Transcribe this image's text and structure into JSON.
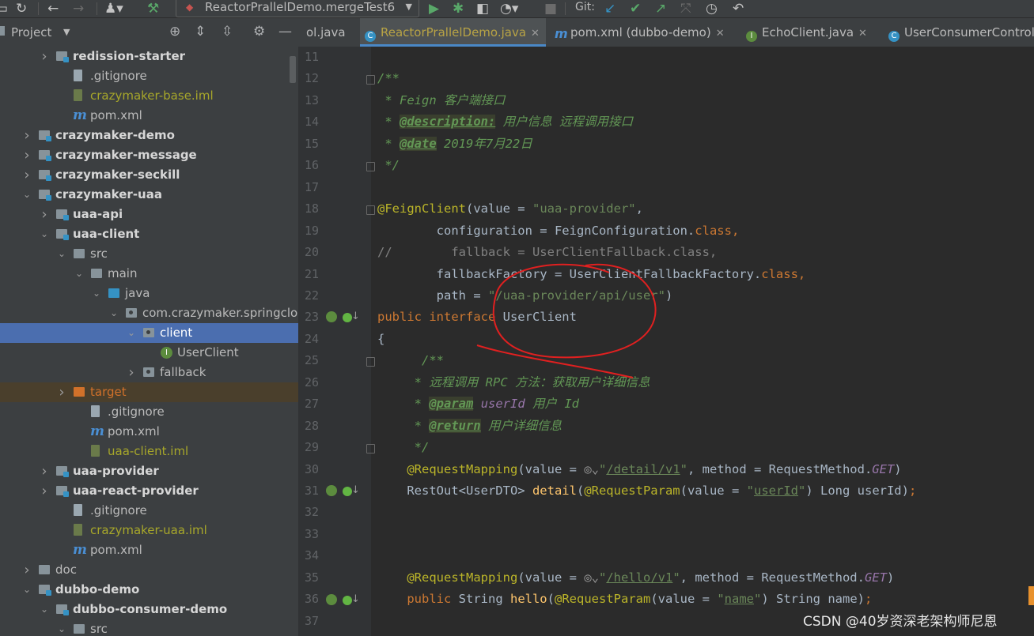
{
  "toolbar": {
    "run_config": "ReactorPrallelDemo.mergeTest6",
    "git_label": "Git:"
  },
  "project_panel": {
    "title": "Project"
  },
  "tree": [
    {
      "label": "redission-starter",
      "style": "bold",
      "icon": "module-folder",
      "indent": 1,
      "arrow": "right"
    },
    {
      "label": ".gitignore",
      "style": "normal",
      "icon": "file",
      "indent": 2,
      "arrow": ""
    },
    {
      "label": "crazymaker-base.iml",
      "style": "yellow",
      "icon": "iml-file",
      "indent": 2,
      "arrow": ""
    },
    {
      "label": "pom.xml",
      "style": "normal",
      "icon": "maven",
      "indent": 2,
      "arrow": ""
    },
    {
      "label": "crazymaker-demo",
      "style": "bold",
      "icon": "module-folder",
      "indent": 0,
      "arrow": "right"
    },
    {
      "label": "crazymaker-message",
      "style": "bold",
      "icon": "module-folder",
      "indent": 0,
      "arrow": "right"
    },
    {
      "label": "crazymaker-seckill",
      "style": "bold",
      "icon": "module-folder",
      "indent": 0,
      "arrow": "right"
    },
    {
      "label": "crazymaker-uaa",
      "style": "bold",
      "icon": "module-folder",
      "indent": 0,
      "arrow": "down"
    },
    {
      "label": "uaa-api",
      "style": "bold",
      "icon": "module-folder",
      "indent": 1,
      "arrow": "right"
    },
    {
      "label": "uaa-client",
      "style": "bold",
      "icon": "module-folder",
      "indent": 1,
      "arrow": "down"
    },
    {
      "label": "src",
      "style": "normal",
      "icon": "folder",
      "indent": 2,
      "arrow": "down"
    },
    {
      "label": "main",
      "style": "normal",
      "icon": "folder",
      "indent": 3,
      "arrow": "down"
    },
    {
      "label": "java",
      "style": "normal",
      "icon": "java-folder",
      "indent": 4,
      "arrow": "down"
    },
    {
      "label": "com.crazymaker.springcloud.u",
      "style": "normal",
      "icon": "package",
      "indent": 5,
      "arrow": "down"
    },
    {
      "label": "client",
      "style": "selected",
      "icon": "package",
      "indent": 6,
      "arrow": "down"
    },
    {
      "label": "UserClient",
      "style": "normal",
      "icon": "interface",
      "indent": 7,
      "arrow": ""
    },
    {
      "label": "fallback",
      "style": "normal",
      "icon": "package",
      "indent": 6,
      "arrow": "right"
    },
    {
      "label": "target",
      "style": "target",
      "icon": "target-folder",
      "indent": 2,
      "arrow": "right"
    },
    {
      "label": ".gitignore",
      "style": "normal",
      "icon": "file",
      "indent": 3,
      "arrow": ""
    },
    {
      "label": "pom.xml",
      "style": "normal",
      "icon": "maven",
      "indent": 3,
      "arrow": ""
    },
    {
      "label": "uaa-client.iml",
      "style": "yellow",
      "icon": "iml-file",
      "indent": 3,
      "arrow": ""
    },
    {
      "label": "uaa-provider",
      "style": "bold",
      "icon": "module-folder",
      "indent": 1,
      "arrow": "right"
    },
    {
      "label": "uaa-react-provider",
      "style": "bold",
      "icon": "module-folder",
      "indent": 1,
      "arrow": "right"
    },
    {
      "label": ".gitignore",
      "style": "normal",
      "icon": "file",
      "indent": 2,
      "arrow": ""
    },
    {
      "label": "crazymaker-uaa.iml",
      "style": "yellow",
      "icon": "iml-file",
      "indent": 2,
      "arrow": ""
    },
    {
      "label": "pom.xml",
      "style": "normal",
      "icon": "maven",
      "indent": 2,
      "arrow": ""
    },
    {
      "label": "doc",
      "style": "normal",
      "icon": "folder",
      "indent": 0,
      "arrow": "right"
    },
    {
      "label": "dubbo-demo",
      "style": "bold",
      "icon": "module-folder",
      "indent": 0,
      "arrow": "down"
    },
    {
      "label": "dubbo-consumer-demo",
      "style": "bold",
      "icon": "module-folder",
      "indent": 1,
      "arrow": "down"
    },
    {
      "label": "src",
      "style": "normal",
      "icon": "folder",
      "indent": 2,
      "arrow": "down"
    }
  ],
  "tabs": [
    {
      "label": "ol.java",
      "icon": "",
      "active": false,
      "close": false
    },
    {
      "label": "ReactorPrallelDemo.java",
      "icon": "class",
      "active": true,
      "close": true
    },
    {
      "label": "pom.xml (dubbo-demo)",
      "icon": "maven",
      "active": false,
      "close": true
    },
    {
      "label": "EchoClient.java",
      "icon": "interface",
      "active": false,
      "close": true
    },
    {
      "label": "UserConsumerControlle",
      "icon": "class",
      "active": false,
      "close": false
    }
  ],
  "code_lines": [
    {
      "n": "11",
      "html": ""
    },
    {
      "n": "12",
      "html": "<span class='c-doc'>/**</span>"
    },
    {
      "n": "13",
      "html": "<span class='c-doc'> * Feign 客户端接口</span>"
    },
    {
      "n": "14",
      "html": "<span class='c-doc'> * </span><span class='c-tag'>@description:</span><span class='c-doc'> 用户信息 远程调用接口</span>"
    },
    {
      "n": "15",
      "html": "<span class='c-doc'> * </span><span class='c-tag'>@date</span><span class='c-doc'> 2019年7月22日</span>"
    },
    {
      "n": "16",
      "html": "<span class='c-doc'> */</span>"
    },
    {
      "n": "17",
      "html": ""
    },
    {
      "n": "18",
      "html": "<span class='c-ann'>@FeignClient</span>(value = <span class='c-str'>\"uaa-provider\"</span>,"
    },
    {
      "n": "19",
      "html": "        configuration = FeignConfiguration.<span class='c-kw'>class,</span>"
    },
    {
      "n": "20",
      "html": "<span class='c-cmt'>//        fallback = UserClientFallback.class,</span>"
    },
    {
      "n": "21",
      "html": "        fallbackFactory = UserClientFallbackFactory.<span class='c-kw'>class,</span>"
    },
    {
      "n": "22",
      "html": "        path = <span class='c-str'>\"/uaa-provider/api/user\"</span>)"
    },
    {
      "n": "23",
      "html": "<span class='c-kw'>public interface</span> UserClient"
    },
    {
      "n": "24",
      "html": "{"
    },
    {
      "n": "25",
      "html": "      <span class='c-doc'>/**</span>"
    },
    {
      "n": "26",
      "html": "     <span class='c-doc'>* 远程调用 RPC 方法：获取用户详细信息</span>"
    },
    {
      "n": "27",
      "html": "     <span class='c-doc'>* </span><span class='c-tag'>@param</span><span class='c-doc'> </span><span class='c-par'>userId</span><span class='c-doc'> 用户 Id</span>"
    },
    {
      "n": "28",
      "html": "     <span class='c-doc'>* </span><span class='c-tag'>@return</span><span class='c-doc'> 用户详细信息</span>"
    },
    {
      "n": "29",
      "html": "     <span class='c-doc'>*/</span>"
    },
    {
      "n": "30",
      "html": "    <span class='c-ann'>@RequestMapping</span>(value = <span style='color:#9a9a9a'>◎⌄</span><span class='c-str'>\"<span class='c-u'>/detail/v1</span>\"</span>, method = RequestMethod.<span class='c-par'>GET</span>)"
    },
    {
      "n": "31",
      "html": "    RestOut&lt;UserDTO&gt; <span class='c-fn'>detail</span>(<span class='c-ann'>@RequestParam</span>(value = <span class='c-str'>\"<span class='c-u'>userId</span>\"</span>) Long userId)<span class='c-kw'>;</span>"
    },
    {
      "n": "32",
      "html": ""
    },
    {
      "n": "33",
      "html": ""
    },
    {
      "n": "34",
      "html": ""
    },
    {
      "n": "35",
      "html": "    <span class='c-ann'>@RequestMapping</span>(value = <span style='color:#9a9a9a'>◎⌄</span><span class='c-str'>\"<span class='c-u'>/hello/v1</span>\"</span>, method = RequestMethod.<span class='c-par'>GET</span>)"
    },
    {
      "n": "36",
      "html": "    <span class='c-kw'>public</span> String <span class='c-fn'>hello</span>(<span class='c-ann'>@RequestParam</span>(value = <span class='c-str'>\"<span class='c-u'>name</span>\"</span>) String name)<span class='c-kw'>;</span>"
    },
    {
      "n": "37",
      "html": ""
    }
  ],
  "watermark": "CSDN @40岁资深老架构师尼恩"
}
